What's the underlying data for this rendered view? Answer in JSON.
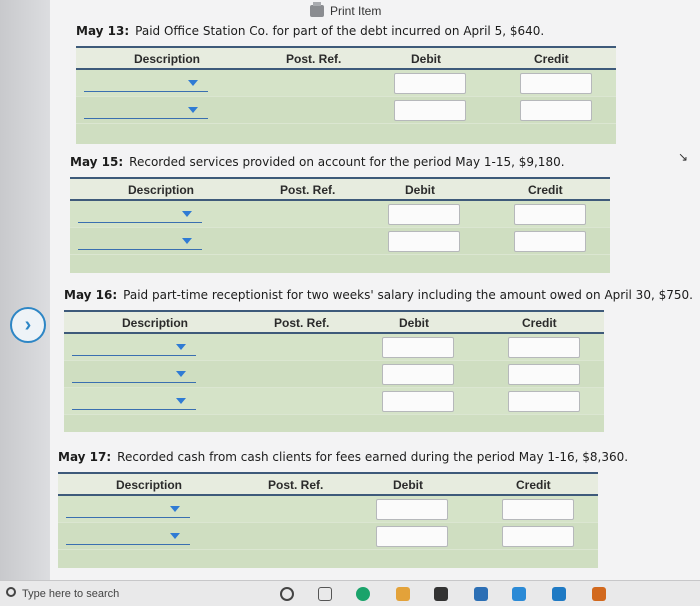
{
  "window": {
    "print_label": "Print Item"
  },
  "columns": {
    "description": "Description",
    "post_ref": "Post. Ref.",
    "debit": "Debit",
    "credit": "Credit"
  },
  "entries": [
    {
      "date": "May 13:",
      "text": "Paid Office Station Co. for part of the debt incurred on April 5, $640."
    },
    {
      "date": "May 15:",
      "text": "Recorded services provided on account for the period May 1-15, $9,180."
    },
    {
      "date": "May 16:",
      "text": "Paid part-time receptionist for two weeks' salary including the amount owed on April 30, $750."
    },
    {
      "date": "May 17:",
      "text": "Recorded cash from cash clients for fees earned during the period May 1-16, $8,360."
    }
  ],
  "taskbar": {
    "search_placeholder": "Type here to search"
  },
  "colors": {
    "header_rule": "#3e5a7a",
    "table_fill": "#cfdec1",
    "dropdown_arrow": "#2f7bd4"
  }
}
